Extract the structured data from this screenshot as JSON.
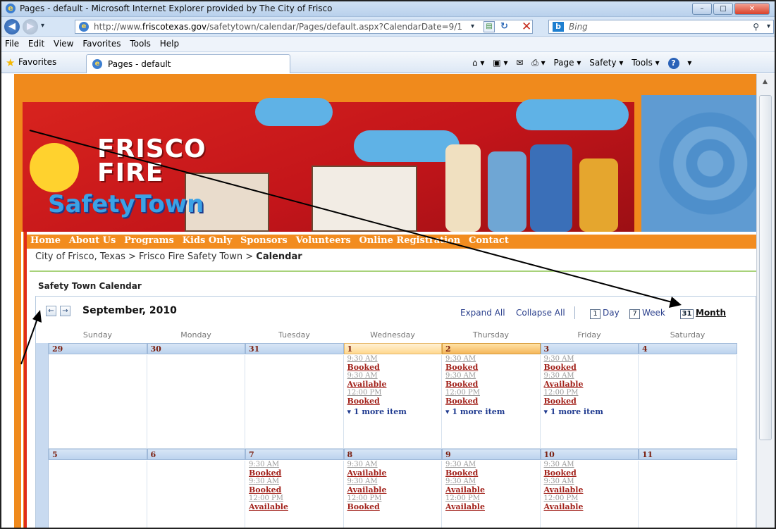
{
  "window": {
    "title": "Pages - default - Microsoft Internet Explorer provided by The City of Frisco",
    "minimize": "–",
    "maximize": "□",
    "close": "✕"
  },
  "address": {
    "url_prefix": "http://www.",
    "url_domain": "friscotexas.gov",
    "url_rest": "/safetytown/calendar/Pages/default.aspx?CalendarDate=9/1",
    "search_placeholder": "Bing"
  },
  "menu": [
    "File",
    "Edit",
    "View",
    "Favorites",
    "Tools",
    "Help"
  ],
  "favorites": {
    "label": "Favorites",
    "tab_title": "Pages - default"
  },
  "toolbar": {
    "page": "Page ▾",
    "safety": "Safety ▾",
    "tools": "Tools ▾"
  },
  "banner": {
    "logo_line1": "FRISCO",
    "logo_line2": "FIRE",
    "logo_line3": "SafetyTown"
  },
  "site_nav": [
    "Home",
    "About Us",
    "Programs",
    "Kids Only",
    "Sponsors",
    "Volunteers",
    "Online Registration",
    "Contact"
  ],
  "breadcrumb": {
    "part1": "City of Frisco, Texas",
    "sep": " > ",
    "part2": "Frisco Fire Safety Town",
    "current": "Calendar"
  },
  "calendar": {
    "title": "Safety Town Calendar",
    "month_label": "September, 2010",
    "prev": "←",
    "next": "→",
    "expand_all": "Expand All",
    "collapse_all": "Collapse All",
    "view_day": "Day",
    "view_week": "Week",
    "view_month": "Month",
    "view_day_icon": "1",
    "view_week_icon": "7",
    "view_month_icon": "31",
    "weekdays": [
      "Sunday",
      "Monday",
      "Tuesday",
      "Wednesday",
      "Thursday",
      "Friday",
      "Saturday"
    ],
    "weeks": [
      {
        "days": [
          {
            "num": "29",
            "events": []
          },
          {
            "num": "30",
            "events": []
          },
          {
            "num": "31",
            "events": []
          },
          {
            "num": "1",
            "events": [
              {
                "time": "9:30 AM",
                "status": "Booked"
              },
              {
                "time": "9:30 AM",
                "status": "Available"
              },
              {
                "time": "12:00 PM",
                "status": "Booked"
              }
            ],
            "more": "▾ 1 more item"
          },
          {
            "num": "2",
            "events": [
              {
                "time": "9:30 AM",
                "status": "Booked"
              },
              {
                "time": "9:30 AM",
                "status": "Booked"
              },
              {
                "time": "12:00 PM",
                "status": "Booked"
              }
            ],
            "more": "▾ 1 more item"
          },
          {
            "num": "3",
            "events": [
              {
                "time": "9:30 AM",
                "status": "Booked"
              },
              {
                "time": "9:30 AM",
                "status": "Available"
              },
              {
                "time": "12:00 PM",
                "status": "Booked"
              }
            ],
            "more": "▾ 1 more item"
          },
          {
            "num": "4",
            "events": []
          }
        ]
      },
      {
        "days": [
          {
            "num": "5",
            "events": []
          },
          {
            "num": "6",
            "events": []
          },
          {
            "num": "7",
            "events": [
              {
                "time": "9:30 AM",
                "status": "Booked"
              },
              {
                "time": "9:30 AM",
                "status": "Booked"
              },
              {
                "time": "12:00 PM",
                "status": "Available"
              }
            ]
          },
          {
            "num": "8",
            "events": [
              {
                "time": "9:30 AM",
                "status": "Available"
              },
              {
                "time": "9:30 AM",
                "status": "Available"
              },
              {
                "time": "12:00 PM",
                "status": "Booked"
              }
            ]
          },
          {
            "num": "9",
            "events": [
              {
                "time": "9:30 AM",
                "status": "Booked"
              },
              {
                "time": "9:30 AM",
                "status": "Available"
              },
              {
                "time": "12:00 PM",
                "status": "Available"
              }
            ]
          },
          {
            "num": "10",
            "events": [
              {
                "time": "9:30 AM",
                "status": "Booked"
              },
              {
                "time": "9:30 AM",
                "status": "Available"
              },
              {
                "time": "12:00 PM",
                "status": "Available"
              }
            ]
          },
          {
            "num": "11",
            "events": []
          }
        ]
      }
    ]
  },
  "colors": {
    "orange": "#f08a1c",
    "nav_text": "#ffffff",
    "booked": "#a2221b",
    "more_link": "#1f3a8f",
    "today_header": "#f5b75c"
  }
}
